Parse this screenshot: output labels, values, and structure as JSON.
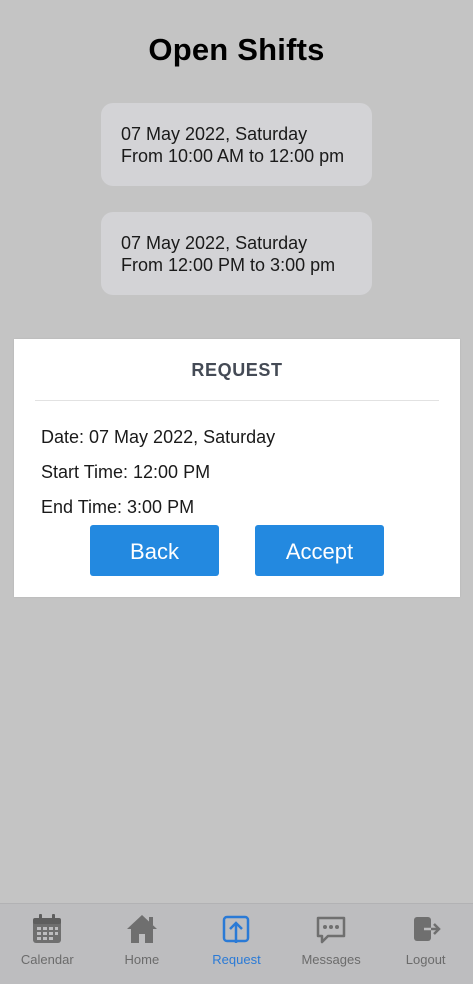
{
  "page": {
    "title": "Open Shifts"
  },
  "shifts": [
    {
      "date": "07 May 2022, Saturday",
      "time": "From 10:00 AM to 12:00 pm"
    },
    {
      "date": "07 May 2022, Saturday",
      "time": "From 12:00 PM to 3:00 pm"
    }
  ],
  "modal": {
    "header": "REQUEST",
    "date": "Date: 07 May 2022, Saturday",
    "start_time": "Start Time: 12:00 PM",
    "end_time": "End Time: 3:00 PM",
    "back_label": "Back",
    "accept_label": "Accept"
  },
  "tabbar": {
    "items": [
      {
        "label": "Calendar",
        "icon": "calendar-icon"
      },
      {
        "label": "Home",
        "icon": "home-icon"
      },
      {
        "label": "Request",
        "icon": "request-upload-icon",
        "active": true
      },
      {
        "label": "Messages",
        "icon": "messages-icon"
      },
      {
        "label": "Logout",
        "icon": "logout-icon"
      }
    ]
  },
  "colors": {
    "accent": "#2389e0",
    "active_tab": "#2a7ad6",
    "inactive_tab": "#6b6b6b"
  }
}
